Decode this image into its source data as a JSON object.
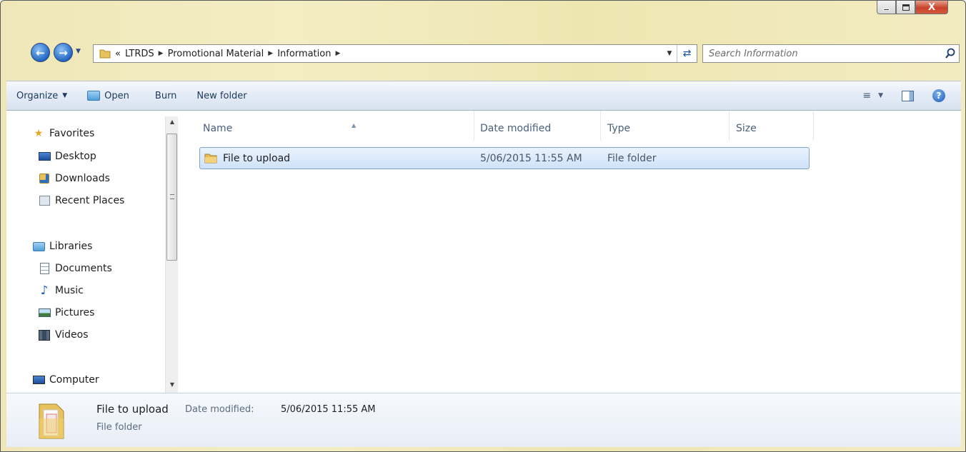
{
  "window": {
    "caption": {
      "minimize": "",
      "maximize": "",
      "close": "X"
    }
  },
  "address": {
    "overflow": "«",
    "crumbs": [
      "LTRDS",
      "Promotional Material",
      "Information"
    ],
    "back_icon": "back-arrow-icon",
    "forward_icon": "forward-arrow-icon"
  },
  "search": {
    "placeholder": "Search Information"
  },
  "toolbar": {
    "organize": "Organize",
    "open": "Open",
    "burn": "Burn",
    "new_folder": "New folder"
  },
  "nav": {
    "favorites": {
      "label": "Favorites",
      "items": [
        "Desktop",
        "Downloads",
        "Recent Places"
      ]
    },
    "libraries": {
      "label": "Libraries",
      "items": [
        "Documents",
        "Music",
        "Pictures",
        "Videos"
      ]
    },
    "computer": "Computer"
  },
  "columns": {
    "name": "Name",
    "date": "Date modified",
    "type": "Type",
    "size": "Size"
  },
  "files": [
    {
      "name": "File to upload",
      "date": "5/06/2015 11:55 AM",
      "type": "File folder",
      "size": "",
      "selected": true
    }
  ],
  "details": {
    "name": "File to upload",
    "date_label": "Date modified:",
    "date_value": "5/06/2015 11:55 AM",
    "type": "File folder"
  },
  "colors": {
    "accent": "#1e58b6",
    "selection": "#cfe2fa",
    "chrome": "#efe7b8"
  }
}
